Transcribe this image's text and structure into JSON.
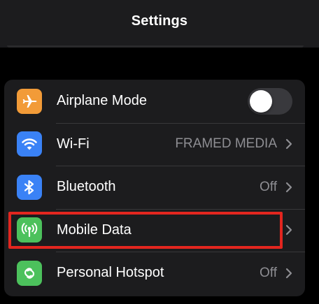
{
  "header": {
    "title": "Settings"
  },
  "colors": {
    "airplane": "#f29b38",
    "wifi": "#3a82f6",
    "bluetooth": "#3a82f6",
    "mobile_data": "#4cc15c",
    "hotspot": "#4cc15c",
    "highlight": "#e3261f"
  },
  "settings": {
    "airplane": {
      "label": "Airplane Mode",
      "icon": "airplane-icon",
      "toggle_on": false
    },
    "wifi": {
      "label": "Wi-Fi",
      "value": "FRAMED MEDIA",
      "icon": "wifi-icon"
    },
    "bluetooth": {
      "label": "Bluetooth",
      "value": "Off",
      "icon": "bluetooth-icon"
    },
    "mobile_data": {
      "label": "Mobile Data",
      "icon": "antenna-icon",
      "highlighted": true
    },
    "hotspot": {
      "label": "Personal Hotspot",
      "value": "Off",
      "icon": "hotspot-icon"
    }
  }
}
